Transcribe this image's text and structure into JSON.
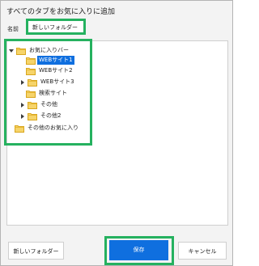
{
  "dialog": {
    "title": "すべてのタブをお気に入りに追加"
  },
  "name_row": {
    "label": "名前",
    "value": "新しいフォルダー"
  },
  "tree": {
    "items": [
      {
        "label": "お気に入りバー",
        "expanded": true,
        "selected": false,
        "has_children": true,
        "indent_level": 0
      },
      {
        "label": "WEBサイト1",
        "expanded": false,
        "selected": true,
        "has_children": false,
        "indent_level": 1
      },
      {
        "label": "WEBサイト2",
        "expanded": false,
        "selected": false,
        "has_children": false,
        "indent_level": 1
      },
      {
        "label": "WEBサイト3",
        "expanded": false,
        "selected": false,
        "has_children": true,
        "indent_level": 1
      },
      {
        "label": "検索サイト",
        "expanded": false,
        "selected": false,
        "has_children": false,
        "indent_level": 1
      },
      {
        "label": "その他",
        "expanded": false,
        "selected": false,
        "has_children": true,
        "indent_level": 1
      },
      {
        "label": "その他2",
        "expanded": false,
        "selected": false,
        "has_children": true,
        "indent_level": 1
      },
      {
        "label": "その他のお気に入り",
        "expanded": false,
        "selected": false,
        "has_children": false,
        "indent_level": 0
      }
    ]
  },
  "buttons": {
    "new_folder": "新しいフォルダー",
    "save": "保存",
    "cancel": "キャンセル"
  },
  "colors": {
    "highlight_green": "#25b15f",
    "accent_blue": "#0f6fdf",
    "folder_yellow": "#f3c94e",
    "dialog_bg": "#f3f3f3"
  }
}
